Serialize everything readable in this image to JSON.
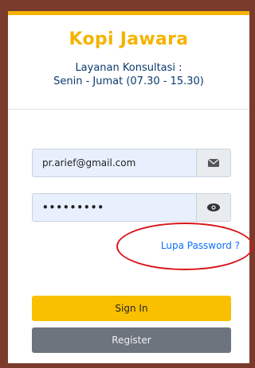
{
  "brand": {
    "title": "Kopi Jawara"
  },
  "service": {
    "line1": "Layanan Konsultasi :",
    "line2": "Senin - Jumat (07.30 - 15.30)"
  },
  "form": {
    "email_value": "pr.arief@gmail.com",
    "email_icon": "envelope-icon",
    "password_value": "•••••••••",
    "password_icon": "eye-icon",
    "forgot_password": "Lupa Password ?"
  },
  "actions": {
    "sign_in": "Sign In",
    "register": "Register"
  },
  "colors": {
    "brand": "#f5b301",
    "page_background": "#7a3b2c",
    "highlight_oval": "#d8161b",
    "register_button": "#6c757d"
  }
}
